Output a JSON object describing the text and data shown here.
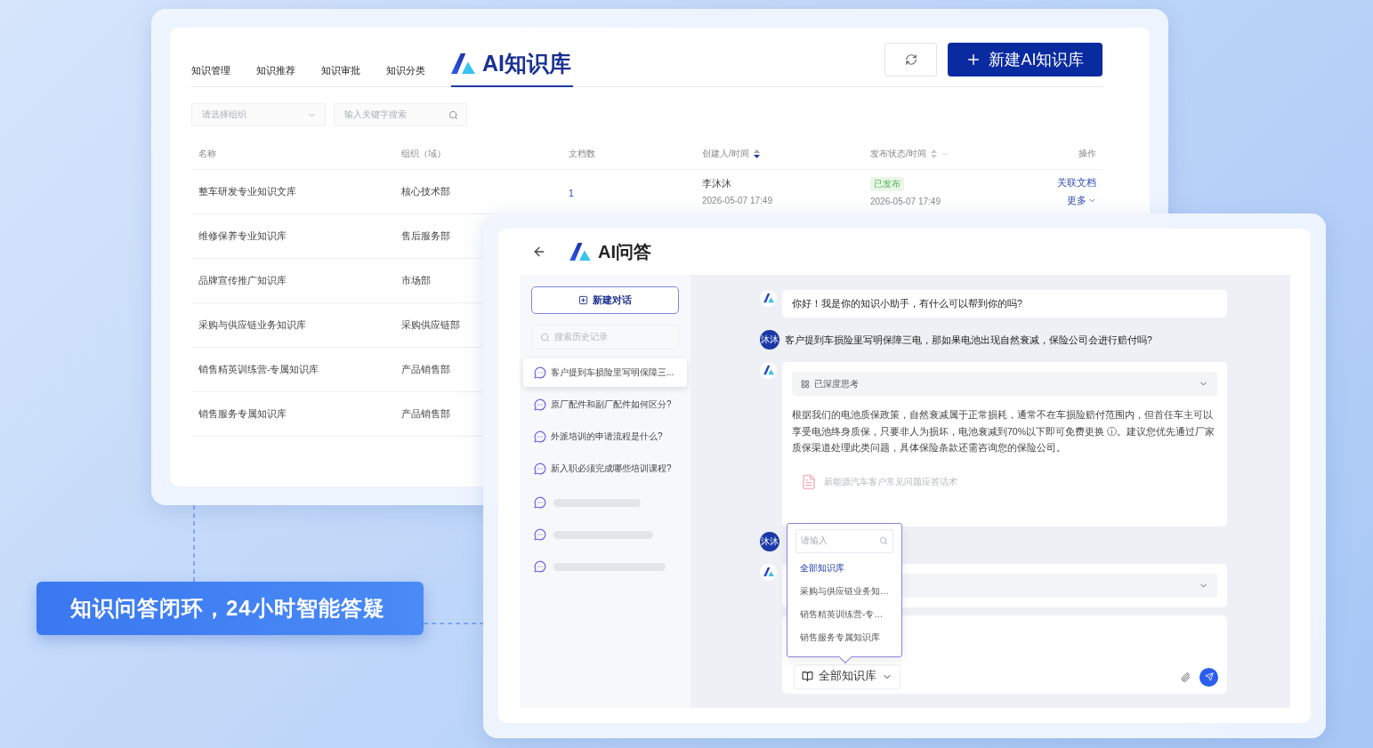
{
  "knowledge_window": {
    "tabs": [
      {
        "label": "知识管理",
        "kind": "plain",
        "selected": false
      },
      {
        "label": "知识推荐",
        "kind": "plain",
        "selected": false
      },
      {
        "label": "知识审批",
        "kind": "plain",
        "selected": false
      },
      {
        "label": "知识分类",
        "kind": "plain",
        "selected": false
      },
      {
        "label": "AI知识库",
        "kind": "brand",
        "selected": true
      }
    ],
    "new_button": "新建AI知识库",
    "filters": {
      "org_placeholder": "请选择组织",
      "search_placeholder": "输入关键字搜索"
    },
    "table": {
      "columns": [
        {
          "label": "名称"
        },
        {
          "label": "组织（域）"
        },
        {
          "label": "文档数"
        },
        {
          "label": "创建人/时间",
          "sort_active": true
        },
        {
          "label": "发布状态/时间",
          "sort_active": false,
          "filter": true
        },
        {
          "label": "操作"
        }
      ],
      "rows": [
        {
          "name": "整车研发专业知识文库",
          "org": "核心技术部",
          "docs": "1",
          "creator": "李沐沐",
          "created": "2026-05-07 17:49",
          "status": "已发布",
          "published": "2026-05-07 17:49",
          "actions": [
            "关联文档",
            "更多"
          ]
        },
        {
          "name": "维修保养专业知识库",
          "org": "售后服务部"
        },
        {
          "name": "品牌宣传推广知识库",
          "org": "市场部"
        },
        {
          "name": "采购与供应链业务知识库",
          "org": "采购供应链部"
        },
        {
          "name": "销售精英训练营-专属知识库",
          "org": "产品销售部"
        },
        {
          "name": "销售服务专属知识库",
          "org": "产品销售部"
        }
      ]
    }
  },
  "qa_window": {
    "title": "AI问答",
    "new_chat": "新建对话",
    "history_search_placeholder": "搜索历史记录",
    "history": [
      {
        "kind": "item",
        "title": "客户提到车损险里写明保障三...",
        "selected": true
      },
      {
        "kind": "item",
        "title": "原厂配件和副厂配件如何区分?",
        "selected": false
      },
      {
        "kind": "item",
        "title": "外派培训的申请流程是什么?",
        "selected": false
      },
      {
        "kind": "item",
        "title": "新入职必须完成哪些培训课程?",
        "selected": false
      },
      {
        "kind": "loading"
      },
      {
        "kind": "loading"
      },
      {
        "kind": "loading"
      }
    ],
    "messages": [
      {
        "kind": "assistant",
        "text": "你好！我是你的知识小助手，有什么可以帮到你的吗?"
      },
      {
        "kind": "user",
        "avatar": "沐沐",
        "text": "客户提到车损险里写明保障三电，那如果电池出现自然衰减，保险公司会进行赔付吗?"
      },
      {
        "kind": "assistant",
        "thinking": {
          "label": "已深度思考",
          "expanded": false
        },
        "text": "根据我们的电池质保政策，自然衰减属于正常损耗，通常不在车损险赔付范围内，但首任车主可以享受电池终身质保，只要非人为损坏，电池衰减到70%以下即可免费更换 ⓘ。建议您优先通过厂家质保渠道处理此类问题，具体保险条款还需咨询您的保险公司。",
        "reference": "新能源汽车客户常见问题应答话术"
      },
      {
        "kind": "user",
        "avatar": "沐沐"
      },
      {
        "kind": "assistant",
        "thinking": {
          "expanded": false
        }
      }
    ],
    "composer": {
      "scope": "全部知识库"
    },
    "scope_dropdown": {
      "search_placeholder": "请输入",
      "options": [
        {
          "label": "全部知识库",
          "selected": true
        },
        {
          "label": "采购与供应链业务知…",
          "selected": false
        },
        {
          "label": "销售精英训练营-专…",
          "selected": false
        },
        {
          "label": "销售服务专属知识库",
          "selected": false
        }
      ]
    }
  },
  "banner": {
    "text": "知识问答闭环，24小时智能答疑"
  }
}
